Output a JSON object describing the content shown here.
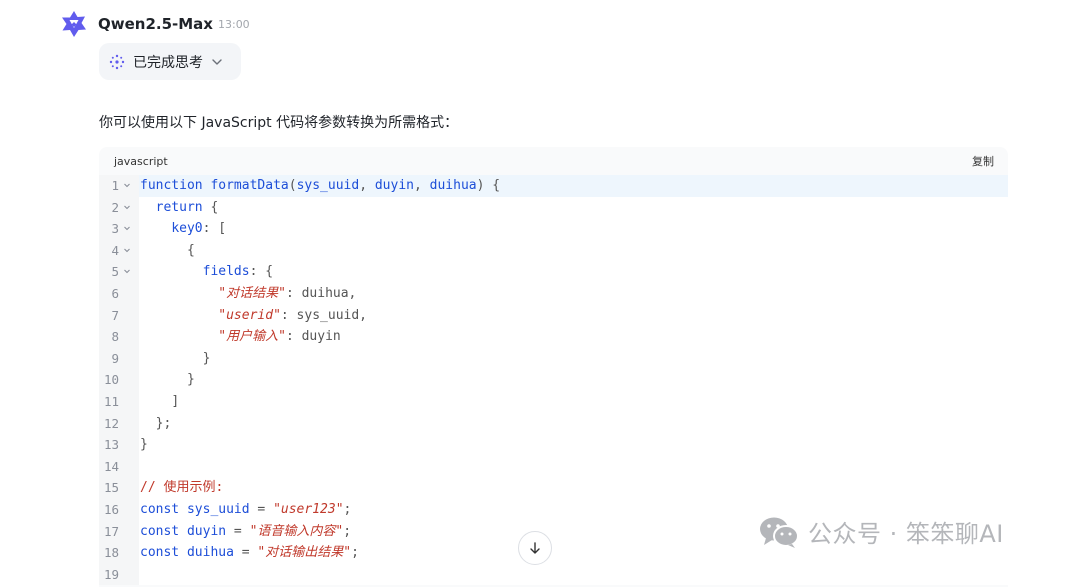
{
  "header": {
    "model_name": "Qwen2.5-Max",
    "time": "13:00"
  },
  "thinking": {
    "label": "已完成思考"
  },
  "message": {
    "intro": "你可以使用以下 JavaScript 代码将参数转换为所需格式："
  },
  "code_block": {
    "language": "javascript",
    "copy_label": "复制",
    "lines": [
      {
        "n": "1",
        "fold": true,
        "tokens": [
          [
            "kw",
            "function "
          ],
          [
            "ident",
            "formatData"
          ],
          [
            "punc",
            "("
          ],
          [
            "ident",
            "sys_uuid"
          ],
          [
            "punc",
            ", "
          ],
          [
            "ident",
            "duyin"
          ],
          [
            "punc",
            ", "
          ],
          [
            "ident",
            "duihua"
          ],
          [
            "punc",
            ") {"
          ]
        ]
      },
      {
        "n": "2",
        "fold": true,
        "tokens": [
          [
            "txt",
            "  "
          ],
          [
            "kw",
            "return"
          ],
          [
            "punc",
            " {"
          ]
        ]
      },
      {
        "n": "3",
        "fold": true,
        "tokens": [
          [
            "txt",
            "    "
          ],
          [
            "ident",
            "key0"
          ],
          [
            "punc",
            ": ["
          ]
        ]
      },
      {
        "n": "4",
        "fold": true,
        "tokens": [
          [
            "txt",
            "      "
          ],
          [
            "punc",
            "{"
          ]
        ]
      },
      {
        "n": "5",
        "fold": true,
        "tokens": [
          [
            "txt",
            "        "
          ],
          [
            "ident",
            "fields"
          ],
          [
            "punc",
            ": {"
          ]
        ]
      },
      {
        "n": "6",
        "fold": false,
        "tokens": [
          [
            "txt",
            "          "
          ],
          [
            "str",
            "\"对话结果\""
          ],
          [
            "punc",
            ": duihua,"
          ]
        ]
      },
      {
        "n": "7",
        "fold": false,
        "tokens": [
          [
            "txt",
            "          "
          ],
          [
            "str",
            "\"userid\""
          ],
          [
            "punc",
            ": sys_uuid,"
          ]
        ]
      },
      {
        "n": "8",
        "fold": false,
        "tokens": [
          [
            "txt",
            "          "
          ],
          [
            "str",
            "\"用户输入\""
          ],
          [
            "punc",
            ": duyin"
          ]
        ]
      },
      {
        "n": "9",
        "fold": false,
        "tokens": [
          [
            "txt",
            "        "
          ],
          [
            "punc",
            "}"
          ]
        ]
      },
      {
        "n": "10",
        "fold": false,
        "tokens": [
          [
            "txt",
            "      "
          ],
          [
            "punc",
            "}"
          ]
        ]
      },
      {
        "n": "11",
        "fold": false,
        "tokens": [
          [
            "txt",
            "    "
          ],
          [
            "punc",
            "]"
          ]
        ]
      },
      {
        "n": "12",
        "fold": false,
        "tokens": [
          [
            "txt",
            "  "
          ],
          [
            "punc",
            "};"
          ]
        ]
      },
      {
        "n": "13",
        "fold": false,
        "tokens": [
          [
            "punc",
            "}"
          ]
        ]
      },
      {
        "n": "14",
        "fold": false,
        "tokens": []
      },
      {
        "n": "15",
        "fold": false,
        "tokens": [
          [
            "cmt",
            "// 使用示例:"
          ]
        ]
      },
      {
        "n": "16",
        "fold": false,
        "tokens": [
          [
            "kw",
            "const "
          ],
          [
            "ident",
            "sys_uuid"
          ],
          [
            "punc",
            " = "
          ],
          [
            "str",
            "\"user123\""
          ],
          [
            "punc",
            ";"
          ]
        ]
      },
      {
        "n": "17",
        "fold": false,
        "tokens": [
          [
            "kw",
            "const "
          ],
          [
            "ident",
            "duyin"
          ],
          [
            "punc",
            " = "
          ],
          [
            "str",
            "\"语音输入内容\""
          ],
          [
            "punc",
            ";"
          ]
        ]
      },
      {
        "n": "18",
        "fold": false,
        "tokens": [
          [
            "kw",
            "const "
          ],
          [
            "ident",
            "duihua"
          ],
          [
            "punc",
            " = "
          ],
          [
            "str",
            "\"对话输出结果\""
          ],
          [
            "punc",
            ";"
          ]
        ]
      },
      {
        "n": "19",
        "fold": false,
        "tokens": []
      }
    ]
  },
  "watermark": {
    "text": "公众号 · 笨笨聊AI"
  },
  "icons": {
    "logo": "qwen-logo-icon",
    "thinking": "sparkle-icon",
    "expand": "chevron-down-icon",
    "scroll": "arrow-down-icon",
    "wechat": "wechat-icon"
  },
  "colors": {
    "accent": "#615ced",
    "keyword": "#1d4ed8",
    "string": "#c0392b",
    "active_line": "#eef6fd"
  }
}
